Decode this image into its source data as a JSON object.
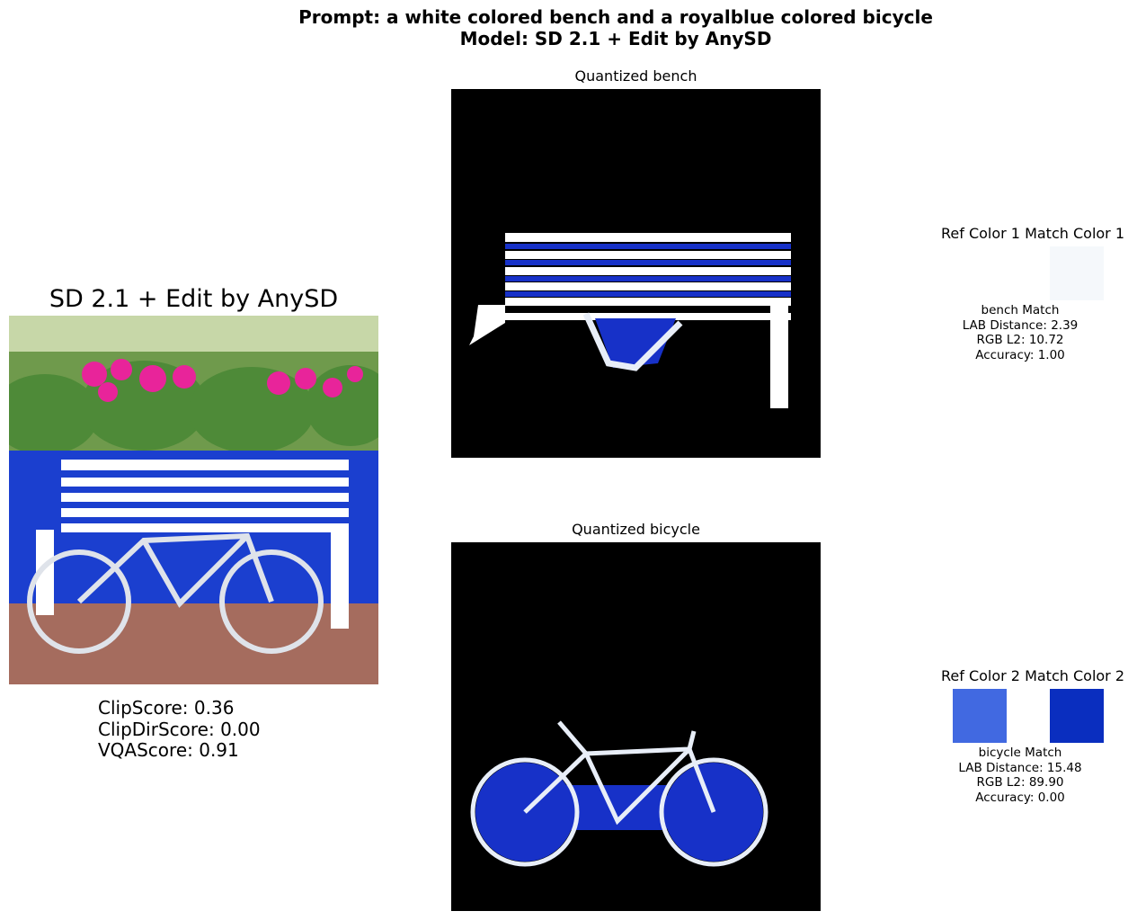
{
  "figure": {
    "prompt_line": "Prompt: a white colored bench and a royalblue colored bicycle",
    "model_line": "Model: SD 2.1 + Edit by AnySD"
  },
  "main_panel": {
    "title": "SD 2.1 + Edit by AnySD",
    "scores": [
      "ClipScore: 0.36",
      "ClipDirScore: 0.00",
      "VQAScore: 0.91"
    ]
  },
  "quantized": [
    {
      "title": "Quantized bench"
    },
    {
      "title": "Quantized bicycle"
    }
  ],
  "color_matches": [
    {
      "header": "Ref Color 1 Match Color 1",
      "ref_color": "#ffffff",
      "match_color": "#f5f8fb",
      "lines": [
        "bench Match",
        "LAB Distance: 2.39",
        "RGB L2: 10.72",
        "Accuracy: 1.00"
      ]
    },
    {
      "header": "Ref Color 2 Match Color 2",
      "ref_color": "#4169e1",
      "match_color": "#0a2ebf",
      "lines": [
        "bicycle Match",
        "LAB Distance: 15.48",
        "RGB L2: 89.90",
        "Accuracy: 0.00"
      ]
    }
  ]
}
